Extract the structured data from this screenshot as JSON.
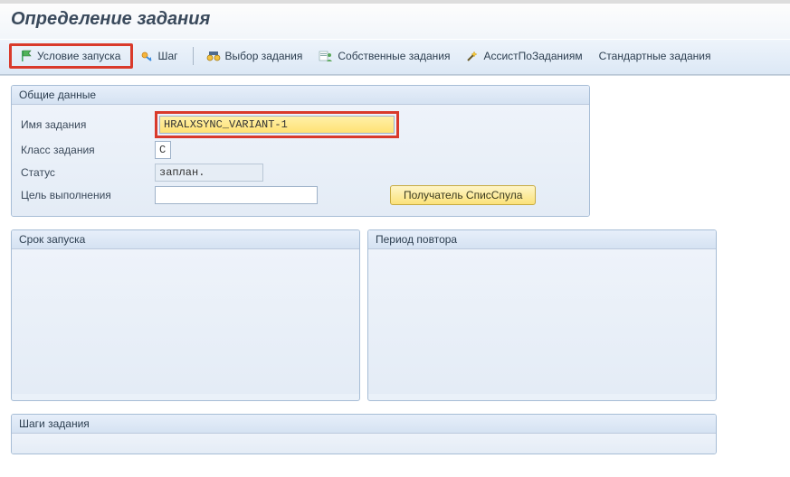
{
  "page_title": "Определение задания",
  "toolbar": {
    "start_condition": "Условие запуска",
    "step": "Шаг",
    "job_selection": "Выбор задания",
    "own_jobs": "Собственные задания",
    "job_wizard": "АссистПоЗаданиям",
    "standard_jobs": "Стандартные задания"
  },
  "general": {
    "title": "Общие данные",
    "job_name_label": "Имя задания",
    "job_name_value": "HRALXSYNC_VARIANT-1",
    "job_class_label": "Класс задания",
    "job_class_value": "C",
    "status_label": "Статус",
    "status_value": "заплан.",
    "exec_target_label": "Цель выполнения",
    "exec_target_value": "",
    "spool_recipient_btn": "Получатель СписСпула"
  },
  "start_panel": {
    "title": "Срок запуска"
  },
  "repeat_panel": {
    "title": "Период повтора"
  },
  "steps_panel": {
    "title": "Шаги задания"
  },
  "colors": {
    "highlight": "#d93a2b"
  }
}
